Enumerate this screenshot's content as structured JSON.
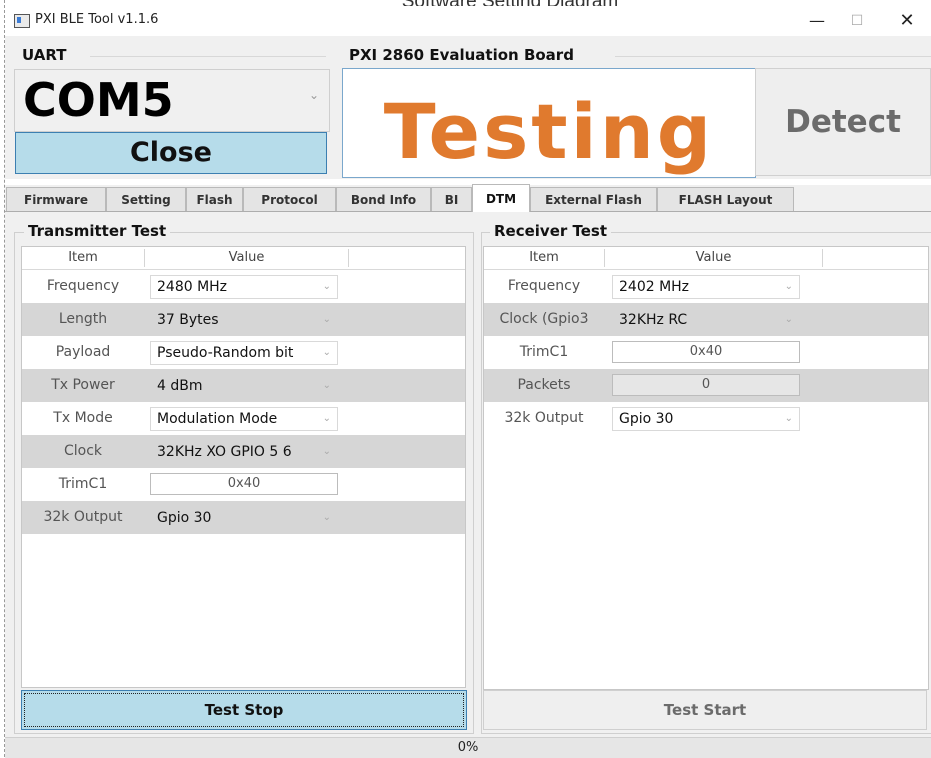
{
  "caption": "Software Setting Diagram",
  "window": {
    "title": "PXI BLE Tool v1.1.6",
    "minimize": "—",
    "maximize": "☐",
    "close": "✕"
  },
  "uart": {
    "legend": "UART",
    "port": "COM5",
    "close_label": "Close"
  },
  "board": {
    "legend": "PXI 2860 Evaluation Board",
    "status": "Testing",
    "detect_label": "Detect",
    "status_color": "#e07a2e"
  },
  "tabs": [
    {
      "label": "Firmware"
    },
    {
      "label": "Setting"
    },
    {
      "label": "Flash"
    },
    {
      "label": "Protocol"
    },
    {
      "label": "Bond Info"
    },
    {
      "label": "BI"
    },
    {
      "label": "DTM",
      "active": true
    },
    {
      "label": "External Flash"
    },
    {
      "label": "FLASH Layout"
    }
  ],
  "transmitter": {
    "legend": "Transmitter Test",
    "headers": {
      "item": "Item",
      "value": "Value"
    },
    "rows": [
      {
        "item": "Frequency",
        "value": "2480 MHz"
      },
      {
        "item": "Length",
        "value": "37 Bytes"
      },
      {
        "item": "Payload",
        "value": "Pseudo-Random bit"
      },
      {
        "item": "Tx Power",
        "value": "4 dBm"
      },
      {
        "item": "Tx Mode",
        "value": "Modulation Mode"
      },
      {
        "item": "Clock",
        "value": "32KHz XO GPIO 5 6"
      },
      {
        "item": "TrimC1",
        "value": "0x40"
      },
      {
        "item": "32k Output",
        "value": "Gpio 30"
      }
    ],
    "button": "Test Stop"
  },
  "receiver": {
    "legend": "Receiver Test",
    "headers": {
      "item": "Item",
      "value": "Value"
    },
    "rows": [
      {
        "item": "Frequency",
        "value": "2402 MHz"
      },
      {
        "item": "Clock (Gpio3",
        "value": "32KHz RC"
      },
      {
        "item": "TrimC1",
        "value": "0x40"
      },
      {
        "item": "Packets",
        "value": "0"
      },
      {
        "item": "32k Output",
        "value": "Gpio 30"
      }
    ],
    "button": "Test Start"
  },
  "status": {
    "progress_text": "0%",
    "progress": 0
  },
  "icons": {
    "app": "app-window-icon",
    "dropdown": "chevron-down-icon"
  }
}
